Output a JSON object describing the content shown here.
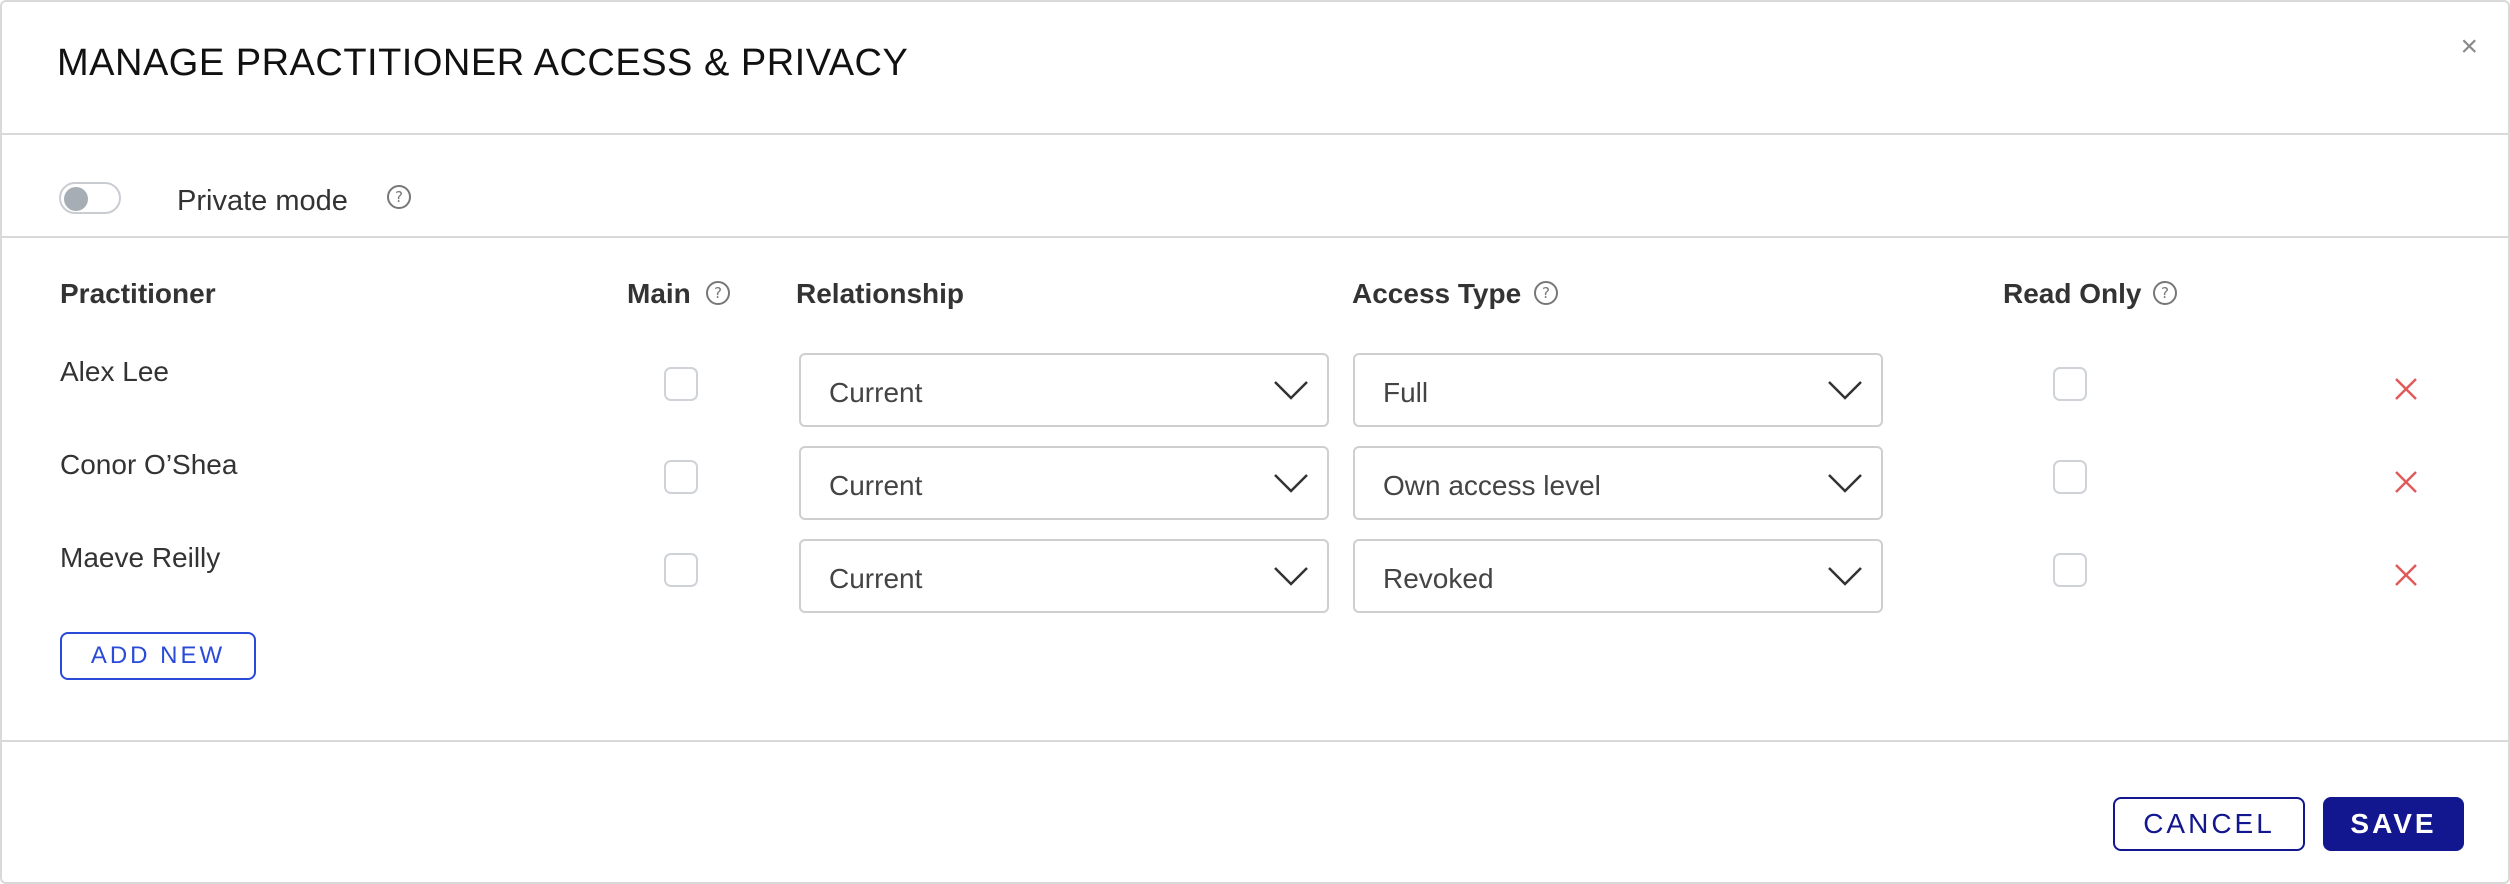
{
  "dialog": {
    "title": "MANAGE PRACTITIONER ACCESS & PRIVACY",
    "close_label": "×"
  },
  "private_mode": {
    "label": "Private mode",
    "enabled": false
  },
  "table": {
    "headers": {
      "practitioner": "Practitioner",
      "main": "Main",
      "relationship": "Relationship",
      "access_type": "Access Type",
      "read_only": "Read Only"
    },
    "rows": [
      {
        "name": "Alex Lee",
        "main": false,
        "relationship": "Current",
        "access_type": "Full",
        "read_only": false
      },
      {
        "name": "Conor O’Shea",
        "main": false,
        "relationship": "Current",
        "access_type": "Own access level",
        "read_only": false
      },
      {
        "name": "Maeve Reilly",
        "main": false,
        "relationship": "Current",
        "access_type": "Revoked",
        "read_only": false
      }
    ]
  },
  "buttons": {
    "add_new": "ADD NEW",
    "cancel": "CANCEL",
    "save": "SAVE"
  },
  "colors": {
    "primary": "#12168f",
    "link_blue": "#2a4bd8",
    "remove_red": "#e05a5a",
    "border": "#d9d9d9"
  },
  "icons": {
    "help": "question-circle-icon",
    "chevron": "chevron-down-icon",
    "remove": "x-icon",
    "close": "close-icon"
  }
}
